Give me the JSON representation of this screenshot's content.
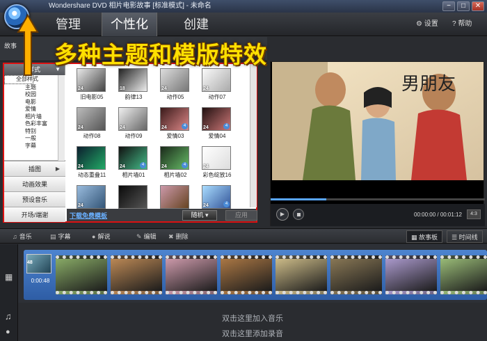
{
  "window": {
    "title": "Wondershare DVD 相片电影故事 [标准模式] - 未命名",
    "controls": [
      "−",
      "□",
      "✕"
    ]
  },
  "nav": {
    "tabs": [
      {
        "label": "管理",
        "active": false
      },
      {
        "label": "个性化",
        "active": true
      },
      {
        "label": "创建",
        "active": false
      }
    ],
    "settings_label": "设置",
    "help_label": "帮助"
  },
  "banner": {
    "text": "多种主题和模版特效",
    "color": "#ffe000"
  },
  "substrip": {
    "label": "故事"
  },
  "template_panel": {
    "category_header": "样式",
    "categories": [
      "全部样式",
      "主题",
      "校园",
      "电影",
      "爱情",
      "相片墙",
      "色彩丰富",
      "特别",
      "一般",
      "字幕"
    ],
    "selected_category": "全部样式",
    "side_buttons": [
      "插图",
      "动画效果",
      "预设音乐",
      "开场/端谢"
    ],
    "thumbnails": [
      {
        "label": "旧电影05",
        "count": "24",
        "badge": false
      },
      {
        "label": "韵律13",
        "count": "18",
        "badge": false
      },
      {
        "label": "动作05",
        "count": "24",
        "badge": false
      },
      {
        "label": "动作07",
        "count": "24",
        "badge": false
      },
      {
        "label": "动作08",
        "count": "24",
        "badge": false
      },
      {
        "label": "动作09",
        "count": "24",
        "badge": false
      },
      {
        "label": "爱情03",
        "count": "24",
        "badge": true
      },
      {
        "label": "爱情04",
        "count": "24",
        "badge": true
      },
      {
        "label": "动态重叠11",
        "count": "24",
        "badge": false
      },
      {
        "label": "相片墙01",
        "count": "24",
        "badge": true
      },
      {
        "label": "相片墙02",
        "count": "24",
        "badge": true
      },
      {
        "label": "彩色绽放16",
        "count": "24",
        "badge": false
      },
      {
        "label": "",
        "count": "24",
        "badge": false
      },
      {
        "label": "",
        "count": "",
        "badge": false
      },
      {
        "label": "",
        "count": "",
        "badge": false
      },
      {
        "label": "",
        "count": "24",
        "badge": true
      }
    ],
    "download_link": "下载免费模板",
    "random_label": "随机",
    "apply_label": "应用"
  },
  "preview": {
    "poster_text": "男朋友",
    "time_current": "00:00:00",
    "time_total": "00:01:12",
    "ratio": "4:3",
    "progress_fraction": 0.26
  },
  "timeline_toolbar": {
    "music": "音乐",
    "caption": "字幕",
    "narration": "解说",
    "edit": "编辑",
    "delete": "删除",
    "storyboard": "故事板",
    "timeline": "时间线"
  },
  "storyboard": {
    "first_clip_count": "48",
    "first_clip_duration": "0:00:48"
  },
  "audio": {
    "music_hint": "双击这里加入音乐",
    "record_hint": "双击这里添加录音"
  }
}
